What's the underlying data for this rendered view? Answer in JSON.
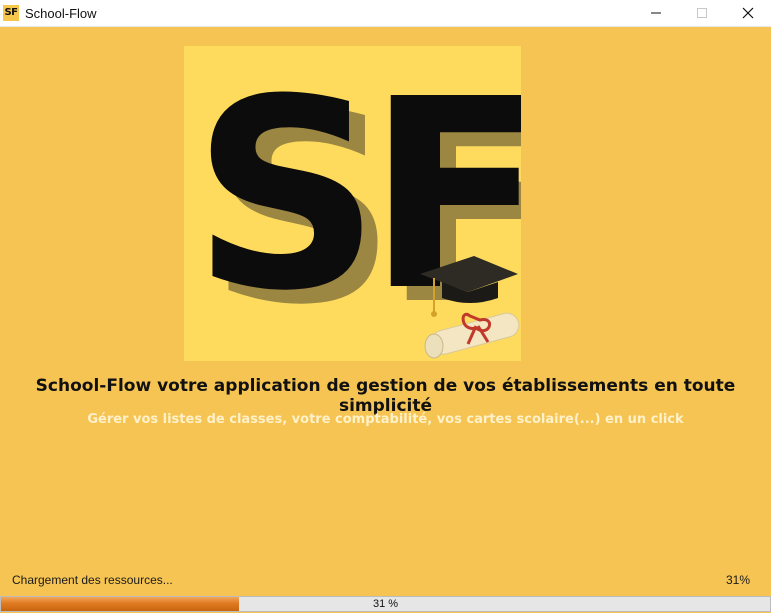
{
  "window": {
    "icon_text": "SF",
    "title": "School-Flow"
  },
  "logo": {
    "letters": "SF",
    "background": "#fedb5c",
    "icons": [
      "graduation-cap-icon",
      "diploma-scroll-icon"
    ]
  },
  "main": {
    "headline": "School-Flow votre application de gestion de vos établissements en toute simplicité",
    "subheadline": "Gérer vos listes de classes, votre comptabilité, vos cartes scolaire(...) en un click"
  },
  "status": {
    "message": "Chargement des ressources...",
    "percent_text": "31%"
  },
  "progress": {
    "value": 0.31,
    "label": "31 %"
  },
  "colors": {
    "background": "#f5c452",
    "progress_fill": "#e07b22",
    "subheadline": "#fff1c9"
  }
}
